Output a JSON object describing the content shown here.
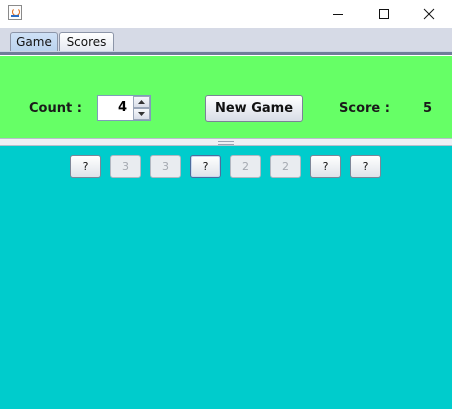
{
  "window": {
    "minimize_icon": "minimize-icon",
    "maximize_icon": "maximize-icon",
    "close_icon": "close-icon"
  },
  "tabs": [
    {
      "label": "Game",
      "active": true
    },
    {
      "label": "Scores",
      "active": false
    }
  ],
  "controls": {
    "count_label": "Count :",
    "count_value": "4",
    "new_game_label": "New Game",
    "score_label": "Score :",
    "score_value": "5"
  },
  "cards": [
    {
      "text": "?",
      "state": "hidden"
    },
    {
      "text": "3",
      "state": "revealed"
    },
    {
      "text": "3",
      "state": "revealed"
    },
    {
      "text": "?",
      "state": "selected"
    },
    {
      "text": "2",
      "state": "revealed"
    },
    {
      "text": "2",
      "state": "revealed"
    },
    {
      "text": "?",
      "state": "hidden"
    },
    {
      "text": "?",
      "state": "hidden"
    }
  ],
  "colors": {
    "control_panel": "#66ff66",
    "board": "#00cccc"
  }
}
